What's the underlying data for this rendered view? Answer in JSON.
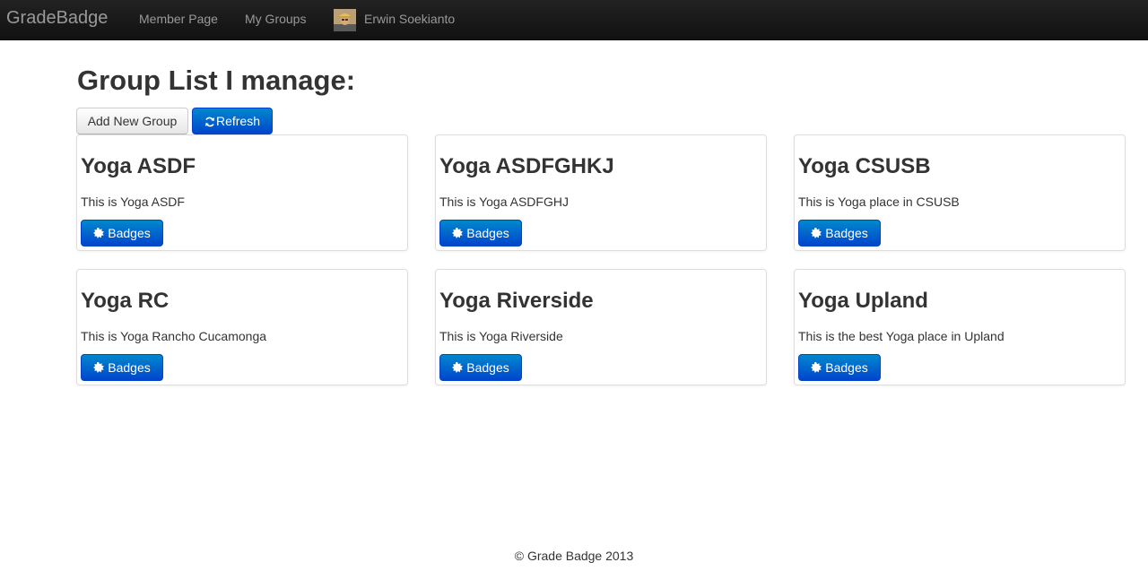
{
  "navbar": {
    "brand": "GradeBadge",
    "links": [
      {
        "label": "Member Page"
      },
      {
        "label": "My Groups"
      }
    ],
    "user": {
      "name": "Erwin Soekianto",
      "avatar_icon": "user-photo"
    }
  },
  "main": {
    "title": "Group List I manage:",
    "add_button": "Add New Group",
    "refresh_button": "Refresh",
    "badges_label": "Badges",
    "groups": [
      {
        "name": "Yoga ASDF",
        "description": "This is Yoga ASDF"
      },
      {
        "name": "Yoga ASDFGHKJ",
        "description": "This is Yoga ASDFGHJ"
      },
      {
        "name": "Yoga CSUSB",
        "description": "This is Yoga place in CSUSB"
      },
      {
        "name": "Yoga RC",
        "description": "This is Yoga Rancho Cucamonga"
      },
      {
        "name": "Yoga Riverside",
        "description": "This is Yoga Riverside"
      },
      {
        "name": "Yoga Upland",
        "description": "This is the best Yoga place in Upland"
      }
    ]
  },
  "footer": {
    "text": "© Grade Badge 2013"
  },
  "colors": {
    "navbar": "#1b1b1b",
    "primary": "#0066cc",
    "text": "#333333"
  }
}
